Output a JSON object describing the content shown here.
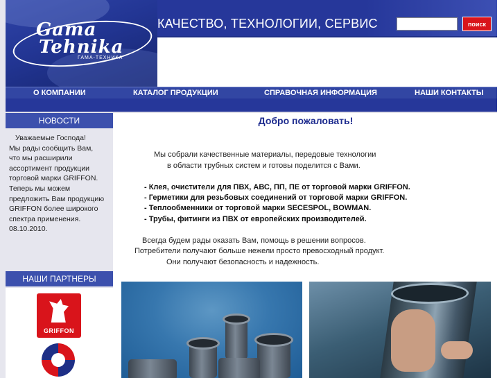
{
  "header": {
    "logo": {
      "line1": "Gama",
      "line2": "Tehnika",
      "subtitle": "ГАМА-ТЕХНИКА"
    },
    "slogan": "КАЧЕСТВО, ТЕХНОЛОГИИ, СЕРВИС",
    "search": {
      "value": "",
      "placeholder": "",
      "button_label": "поиск"
    }
  },
  "nav": {
    "items": [
      {
        "label": "О КОМПАНИИ"
      },
      {
        "label": "КАТАЛОГ ПРОДУКЦИИ"
      },
      {
        "label": "СПРАВОЧНАЯ ИНФОРМАЦИЯ"
      },
      {
        "label": "НАШИ КОНТАКТЫ"
      }
    ]
  },
  "sidebar": {
    "news": {
      "heading": "НОВОСТИ",
      "lines": [
        "Уважаемые Господа!",
        "Мы рады сообщить Вам,",
        "что мы расширили",
        "ассортимент продукции",
        "торговой марки GRIFFON.",
        "Теперь мы можем",
        "предложить Вам продукцию",
        "GRIFFON более широкого",
        "спектра применения.",
        "08.10.2010."
      ]
    },
    "partners": {
      "heading": "НАШИ ПАРТНЕРЫ",
      "logos": [
        {
          "name": "GRIFFON",
          "color": "#d9141b"
        },
        {
          "name": "SECESPOL",
          "color": "#1e2f86"
        }
      ]
    }
  },
  "content": {
    "welcome": "Добро пожаловать!",
    "intro": [
      "Мы собрали качественные материалы, передовые технологии",
      "в области  трубных систем и готовы поделится с Вами."
    ],
    "bullets": [
      "- Клея, очистители для ПВХ, АВС, ПП, ПЕ от торговой марки GRIFFON.",
      "- Герметики для резьбовых соединений от торговой марки GRIFFON.",
      "- Теплообменники от торговой марки SECESPOL, BOWMAN.",
      "- Трубы, фитинги из ПВХ от европейских производителей."
    ],
    "closing": [
      "Всегда будем рады оказать Вам, помощь в решении  вопросов.",
      "Потребители получают больше нежели просто превосходный продукт.",
      "Они получают безопасность и надежность."
    ]
  },
  "colors": {
    "brand_blue": "#1e2f86",
    "nav_blue": "#3246a3",
    "accent_red": "#d9141b",
    "welcome_text": "#1c2a8e"
  }
}
